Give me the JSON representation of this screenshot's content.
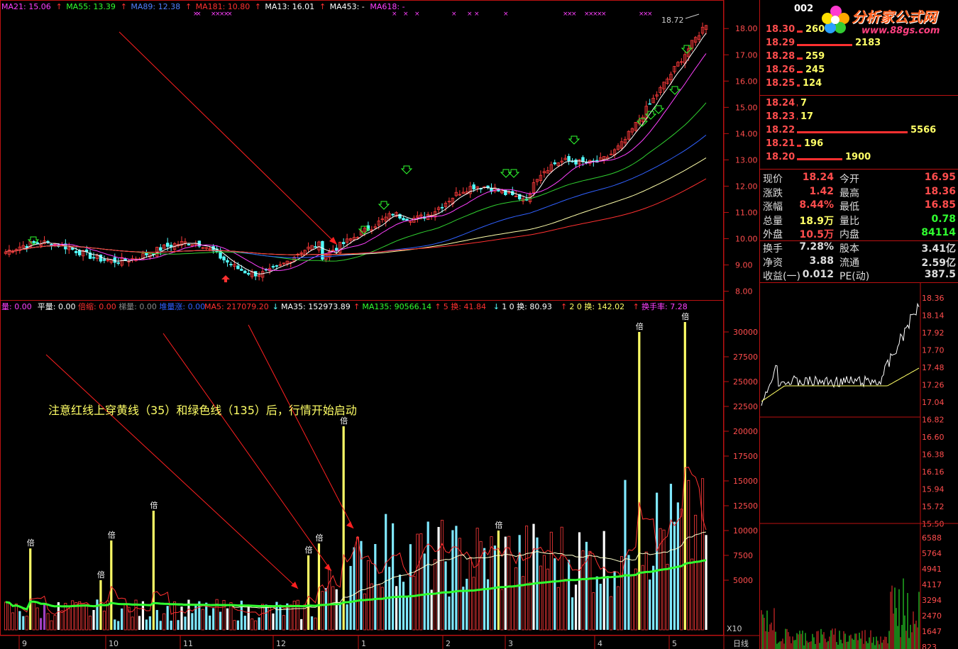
{
  "colors": {
    "up": "#ff3b3b",
    "down": "#54ffff",
    "axis": "#b11",
    "ma5": "#ff3030",
    "ma35": "#ffffff",
    "ma135": "#30ff30",
    "ma21": "#ffffff",
    "ma55": "#ff40ff",
    "ma89": "#20d020",
    "ma181": "#3060ff",
    "ma13": "#ffffaa",
    "ma453": "#ff8040",
    "arrow": "#ff2020",
    "note": "#ffff66"
  },
  "top_legend": [
    {
      "text": "MA21: 15.06",
      "color": "#ff40ff"
    },
    {
      "text": "↑",
      "color": "#ff3030"
    },
    {
      "text": "MA55: 13.39",
      "color": "#30ff30"
    },
    {
      "text": "↑",
      "color": "#ff3030"
    },
    {
      "text": "MA89: 12.38",
      "color": "#5080ff"
    },
    {
      "text": "↑",
      "color": "#ff3030"
    },
    {
      "text": "MA181: 10.80",
      "color": "#ff3030"
    },
    {
      "text": "↑",
      "color": "#ff3030"
    },
    {
      "text": "MA13: 16.01",
      "color": "#ffffff"
    },
    {
      "text": "↑",
      "color": "#ff3030"
    },
    {
      "text": "MA453: -",
      "color": "#ffffff"
    },
    {
      "text": "MA618: -",
      "color": "#ff40ff"
    }
  ],
  "vol_legend": [
    {
      "text": "量: 0.00",
      "color": "#ff40ff"
    },
    {
      "text": "平量: 0.00",
      "color": "#ffffff"
    },
    {
      "text": "倍缩: 0.00",
      "color": "#ff3030"
    },
    {
      "text": "梯量: 0.00",
      "color": "#888888"
    },
    {
      "text": "堆量涨: 0.00",
      "color": "#3060ff"
    },
    {
      "text": "MA5: 217079.20",
      "color": "#ff3030"
    },
    {
      "text": "↓",
      "color": "#54ffff"
    },
    {
      "text": "MA35: 152973.89",
      "color": "#ffffff"
    },
    {
      "text": "↑",
      "color": "#ff3030"
    },
    {
      "text": "MA135: 90566.14",
      "color": "#30ff30"
    },
    {
      "text": "↑",
      "color": "#ff3030"
    },
    {
      "text": "5 换: 41.84",
      "color": "#ff3030"
    },
    {
      "text": "↓",
      "color": "#54ffff"
    },
    {
      "text": "1 0 换: 80.93",
      "color": "#ffffff"
    },
    {
      "text": "↑",
      "color": "#ff3030"
    },
    {
      "text": "2 0 换: 142.02",
      "color": "#ffff66"
    },
    {
      "text": "↑",
      "color": "#ff3030"
    },
    {
      "text": "换手率: 7.28",
      "color": "#ff40ff"
    }
  ],
  "annotation": {
    "text": "注意红线上穿黄线（35）和绿色线（135）后，行情开始启动"
  },
  "chart_data": [
    {
      "type": "candlestick",
      "ylim": [
        7.8,
        18.6
      ],
      "y_ticks": [
        "18.00",
        "17.00",
        "16.00",
        "15.00",
        "14.00",
        "13.00",
        "12.00",
        "11.00",
        "10.00",
        "9.00",
        "8.00"
      ],
      "x_ticks": [
        "9",
        "10",
        "11",
        "12",
        "1",
        "2",
        "3",
        "4",
        "5"
      ],
      "high_label": "18.72",
      "last_price": 18.24
    },
    {
      "type": "bar",
      "name": "volume",
      "ylim": [
        0,
        32000
      ],
      "y_ticks": [
        "30000",
        "27500",
        "25000",
        "22500",
        "20000",
        "17500",
        "15000",
        "12500",
        "10000",
        "7500",
        "5000"
      ],
      "unit_label": "X10",
      "marker_text": "倍"
    },
    {
      "type": "line",
      "name": "intraday",
      "y_ticks": [
        "18.36",
        "18.14",
        "17.92",
        "17.70",
        "17.48",
        "17.26",
        "17.04",
        "16.82",
        "16.60",
        "16.38",
        "16.16",
        "15.94",
        "15.72",
        "15.50"
      ],
      "vol_ticks": [
        "6588",
        "5764",
        "4941",
        "4117",
        "3294",
        "2470",
        "1647",
        "823"
      ]
    }
  ],
  "bottom_label": "日线",
  "panel": {
    "code": "002",
    "logo_text": "分析家公式网",
    "logo_url": "www.88gs.com",
    "asks": [
      {
        "price": "18.30",
        "vol": "260",
        "bar": 8
      },
      {
        "price": "18.29",
        "vol": "2183",
        "bar": 78
      },
      {
        "price": "18.28",
        "vol": "259",
        "bar": 8
      },
      {
        "price": "18.26",
        "vol": "245",
        "bar": 8
      },
      {
        "price": "18.25",
        "vol": "124",
        "bar": 4
      }
    ],
    "bids": [
      {
        "price": "18.24",
        "vol": "7",
        "bar": 1
      },
      {
        "price": "18.23",
        "vol": "17",
        "bar": 1
      },
      {
        "price": "18.22",
        "vol": "5566",
        "bar": 156
      },
      {
        "price": "18.21",
        "vol": "196",
        "bar": 6
      },
      {
        "price": "18.20",
        "vol": "1900",
        "bar": 64
      }
    ],
    "info": [
      {
        "l1": "现价",
        "v1": "18.24",
        "c1": "#ff4d4d",
        "l2": "今开",
        "v2": "16.95",
        "c2": "#ff4d4d"
      },
      {
        "l1": "涨跌",
        "v1": "1.42",
        "c1": "#ff4d4d",
        "l2": "最高",
        "v2": "18.36",
        "c2": "#ff4d4d"
      },
      {
        "l1": "涨幅",
        "v1": "8.44%",
        "c1": "#ff4d4d",
        "l2": "最低",
        "v2": "16.85",
        "c2": "#ff4d4d"
      },
      {
        "l1": "总量",
        "v1": "18.9万",
        "c1": "#ffff66",
        "l2": "量比",
        "v2": "0.78",
        "c2": "#30ff30"
      },
      {
        "l1": "外盘",
        "v1": "10.5万",
        "c1": "#ff4d4d",
        "l2": "内盘",
        "v2": "84114",
        "c2": "#30ff30"
      }
    ],
    "info2": [
      {
        "l1": "换手",
        "v1": "7.28%",
        "c1": "#ddd",
        "l2": "股本",
        "v2": "3.41亿",
        "c2": "#ddd"
      },
      {
        "l1": "净资",
        "v1": "3.88",
        "c1": "#ddd",
        "l2": "流通",
        "v2": "2.59亿",
        "c2": "#ddd"
      },
      {
        "l1": "收益(一)",
        "v1": "0.012",
        "c1": "#ddd",
        "l2": "PE(动)",
        "v2": "387.5",
        "c2": "#ddd"
      }
    ]
  }
}
